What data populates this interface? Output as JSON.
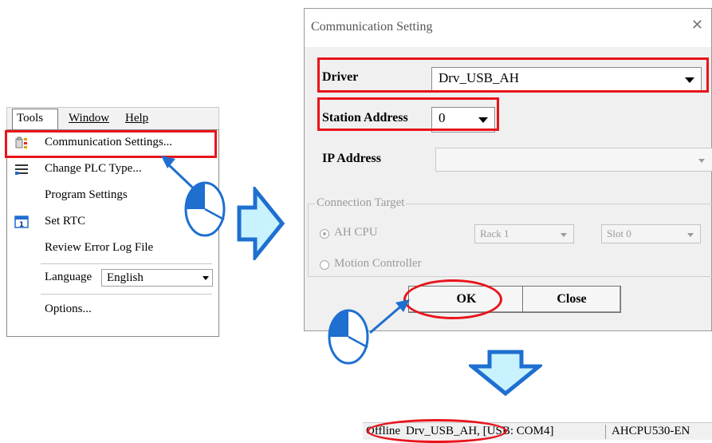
{
  "menubar": {
    "items": [
      {
        "label": "Tools"
      },
      {
        "label": "Window"
      },
      {
        "label": "Help"
      }
    ]
  },
  "tools_menu": {
    "items": [
      {
        "label": "Communication Settings...",
        "icon": "communication-icon"
      },
      {
        "label": "Change PLC Type...",
        "icon": "plc-type-icon"
      },
      {
        "label": "Program Settings"
      },
      {
        "label": "Set RTC",
        "icon": "calendar-icon"
      },
      {
        "label": "Review Error Log File"
      },
      {
        "label": "Options..."
      }
    ],
    "language": {
      "label": "Language",
      "value": "English"
    }
  },
  "dialog": {
    "title": "Communication Setting",
    "driver_label": "Driver",
    "driver_value": "Drv_USB_AH",
    "station_label": "Station Address",
    "station_value": "0",
    "ip_label": "IP Address",
    "ip_value": "",
    "connection_target": {
      "legend": "Connection Target",
      "ah_cpu_label": "AH CPU",
      "rack_value": "Rack 1",
      "slot_value": "Slot 0",
      "motion_label": "Motion Controller"
    },
    "ok_label": "OK",
    "close_label": "Close"
  },
  "statusbar": {
    "mode": "Offline",
    "connection": "Drv_USB_AH, [USB: COM4]",
    "plc_model": "AHCPU530-EN"
  },
  "colors": {
    "highlight": "#e8141b",
    "arrow_fill": "#c9f2ff",
    "arrow_stroke": "#1e6fd0",
    "cursor": "#1e6fd0"
  }
}
